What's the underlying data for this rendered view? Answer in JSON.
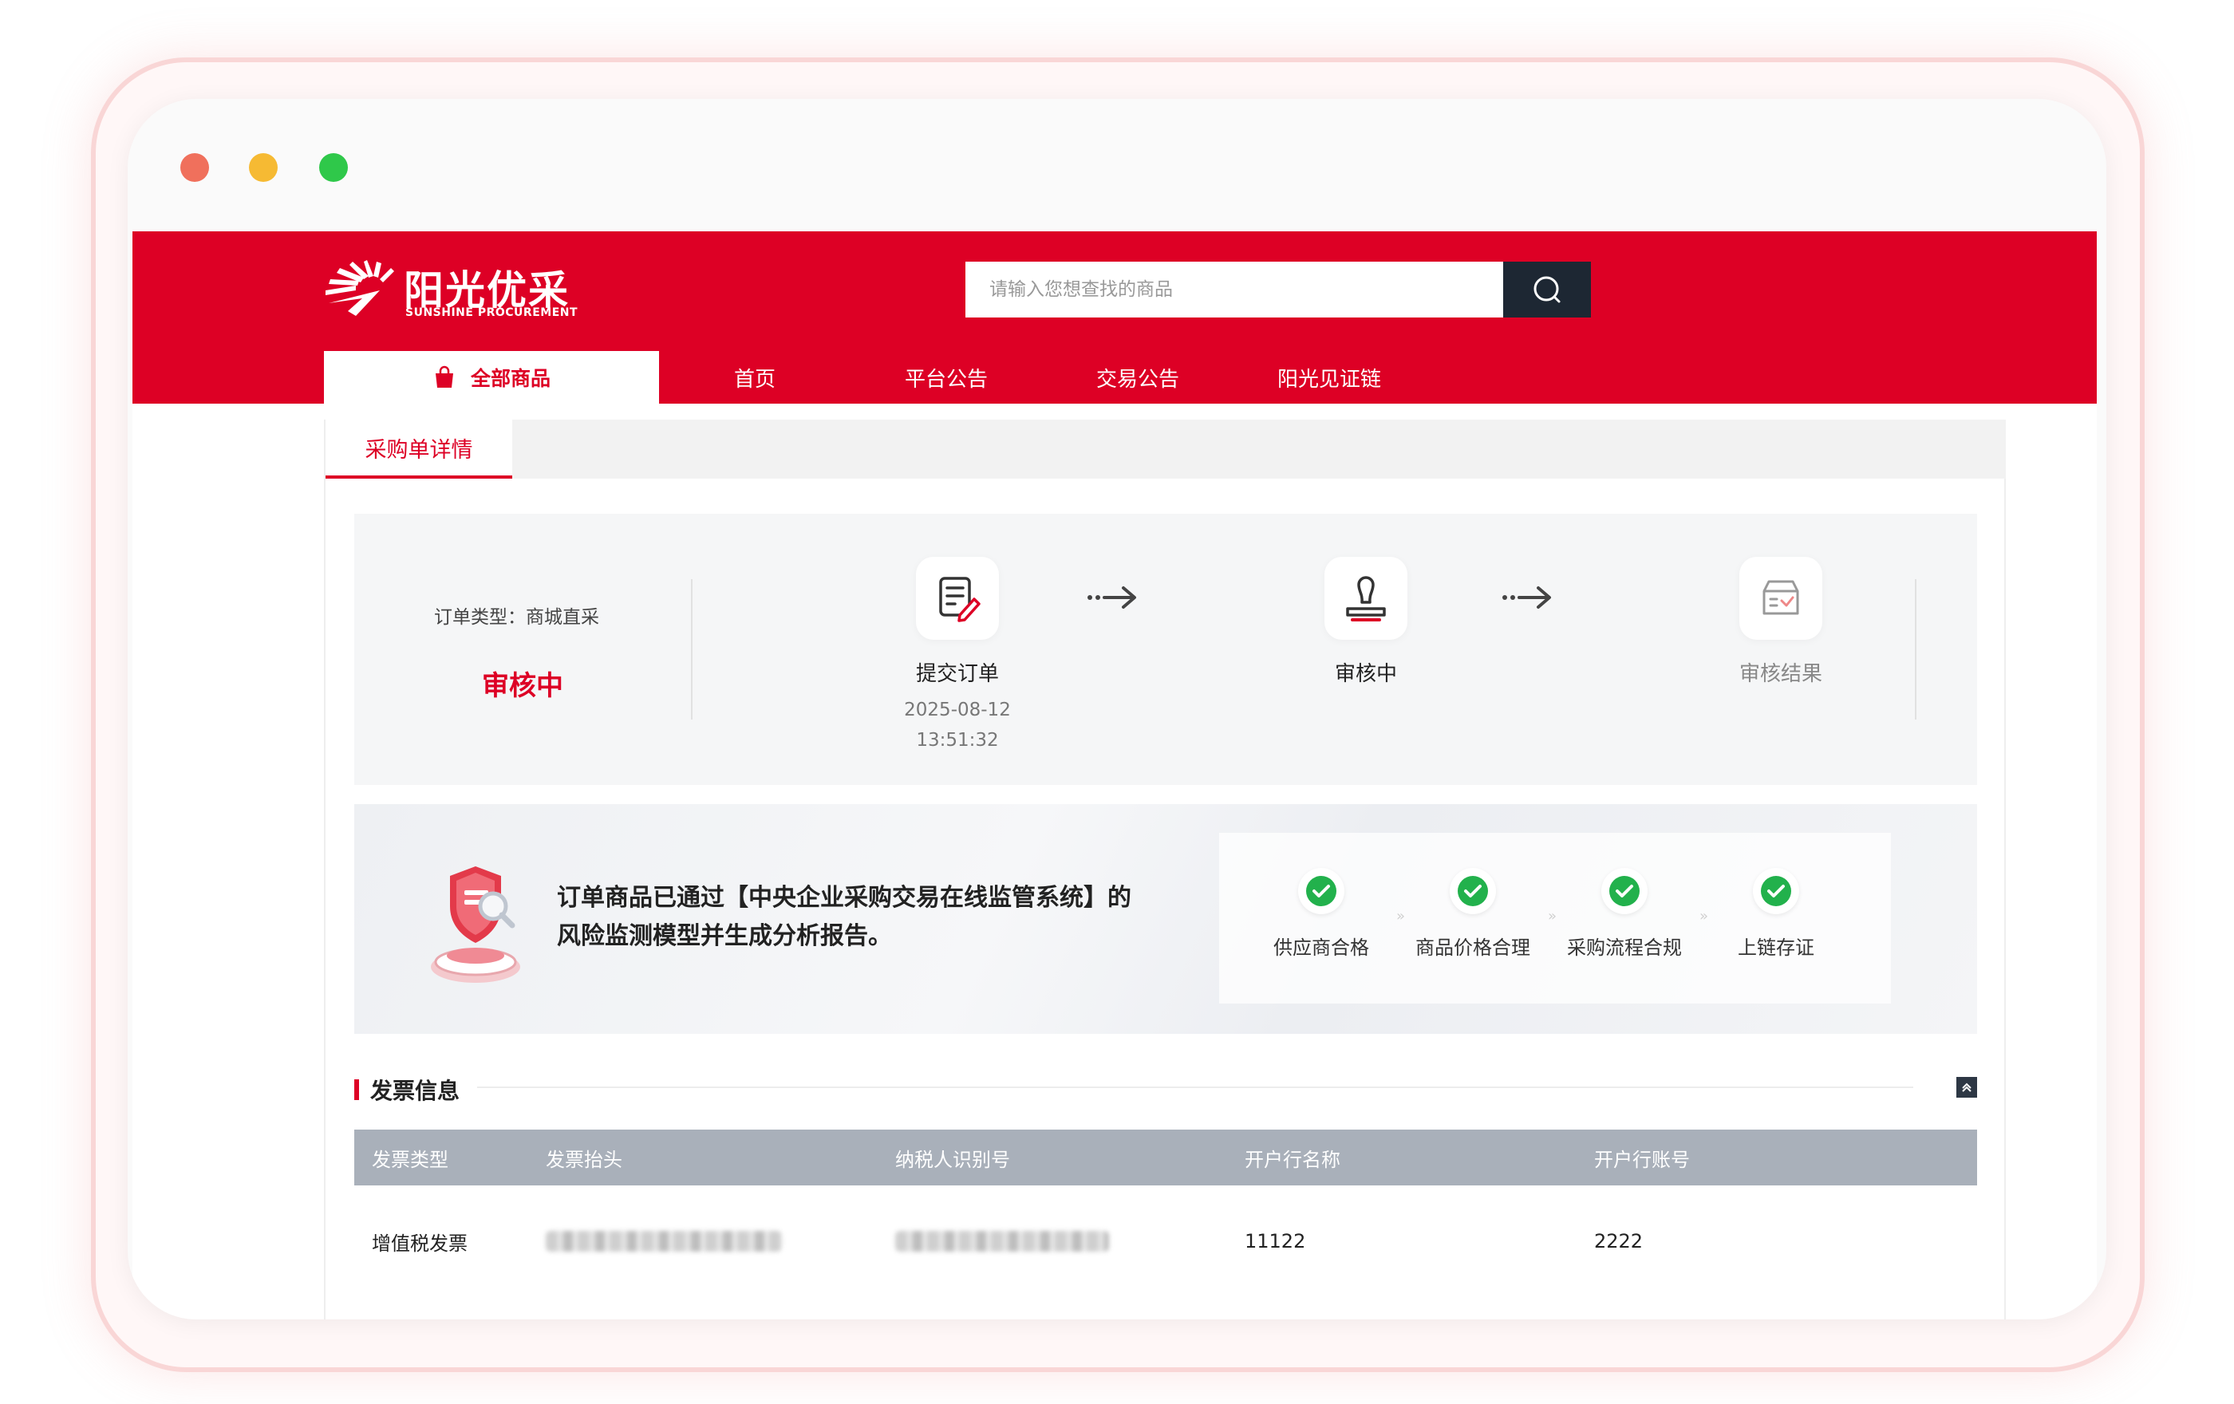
{
  "window": {
    "controls": [
      "close",
      "minimize",
      "maximize"
    ]
  },
  "header": {
    "logo_cn": "阳光优采",
    "logo_en": "SUNSHINE PROCUREMENT",
    "search_placeholder": "请输入您想查找的商品",
    "brand_color": "#dd0025"
  },
  "nav": {
    "all_products": "全部商品",
    "items": [
      "首页",
      "平台公告",
      "交易公告",
      "阳光见证链"
    ]
  },
  "tab": {
    "label": "采购单详情"
  },
  "order": {
    "type_text": "订单类型：商城直采",
    "status": "审核中",
    "steps": [
      {
        "label": "提交订单",
        "date": "2025-08-12",
        "time": "13:51:32",
        "icon": "edit-document-icon"
      },
      {
        "label": "审核中",
        "icon": "stamp-icon"
      },
      {
        "label": "审核结果",
        "icon": "inbox-check-icon"
      }
    ]
  },
  "risk": {
    "line1": "订单商品已通过【中央企业采购交易在线监管系统】的",
    "line2": "风险监测模型并生成分析报告。",
    "checks": [
      "供应商合格",
      "商品价格合理",
      "采购流程合规",
      "上链存证"
    ]
  },
  "invoice": {
    "section_title": "发票信息",
    "columns": [
      "发票类型",
      "发票抬头",
      "纳税人识别号",
      "开户行名称",
      "开户行账号"
    ],
    "row": {
      "type": "增值税发票",
      "bank_name": "11122",
      "bank_account": "2222"
    }
  }
}
